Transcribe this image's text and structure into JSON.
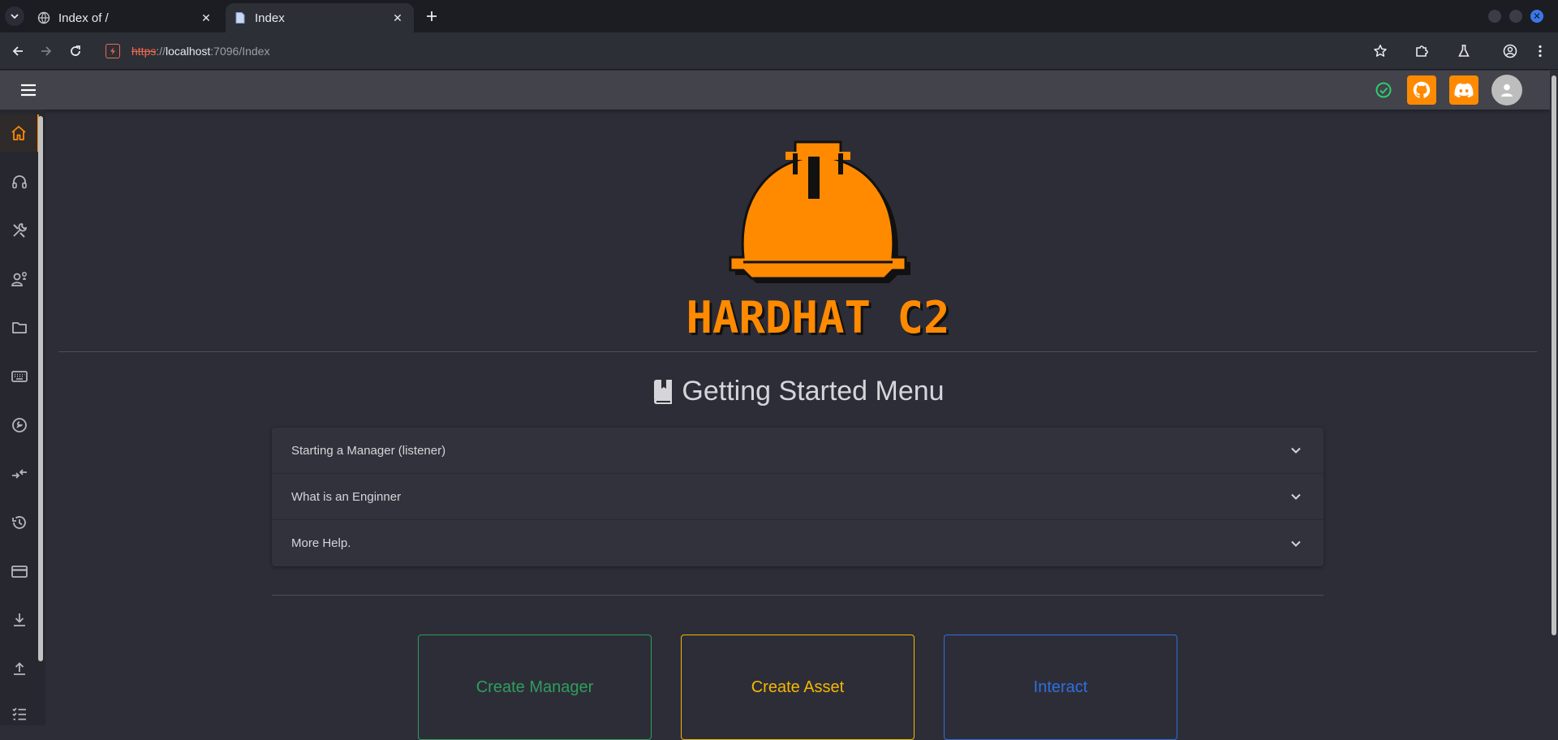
{
  "browser": {
    "tabs": [
      {
        "title": "Index of /",
        "active": false
      },
      {
        "title": "Index",
        "active": true
      }
    ],
    "url": {
      "protocol": "https",
      "separator": "://",
      "host": "localhost",
      "rest": ":7096/Index"
    }
  },
  "colors": {
    "accent": "#ff8a00",
    "manager": "#2e9e5b",
    "asset": "#f5b800",
    "interact": "#2f6fe0"
  },
  "header": {
    "status_icon": "check-circle-icon",
    "buttons": [
      "github-icon",
      "discord-icon"
    ],
    "avatar_icon": "user-icon"
  },
  "sidebar": {
    "items": [
      {
        "icon": "home-icon",
        "active": true
      },
      {
        "icon": "headset-icon"
      },
      {
        "icon": "tools-icon"
      },
      {
        "icon": "users-gear-icon"
      },
      {
        "icon": "folder-icon"
      },
      {
        "icon": "keyboard-icon"
      },
      {
        "icon": "wrench-circle-icon"
      },
      {
        "icon": "merge-icon"
      },
      {
        "icon": "history-icon"
      },
      {
        "icon": "card-icon"
      },
      {
        "icon": "download-icon"
      },
      {
        "icon": "upload-icon"
      },
      {
        "icon": "checklist-icon"
      }
    ]
  },
  "main": {
    "logo_text": "HARDHAT C2",
    "getting_started": {
      "title": "Getting Started Menu",
      "items": [
        {
          "label": "Starting a Manager (listener)"
        },
        {
          "label": "What is an Enginner"
        },
        {
          "label": "More Help."
        }
      ]
    },
    "actions": [
      {
        "label": "Create Manager"
      },
      {
        "label": "Create Asset"
      },
      {
        "label": "Interact"
      }
    ]
  }
}
